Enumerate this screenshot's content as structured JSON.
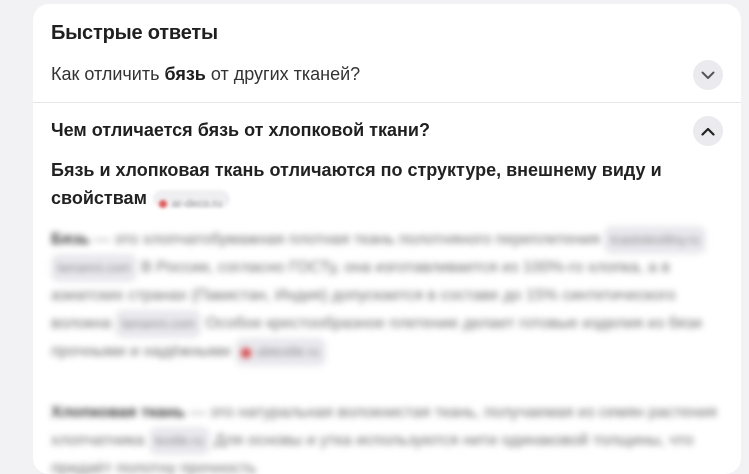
{
  "panel": {
    "title": "Быстрые ответы",
    "question1": {
      "prefix": "Как отличить ",
      "bold": "бязь",
      "suffix": " от других тканей?"
    },
    "question2": "Чем отличается бязь от хлопковой ткани?",
    "answer_lead": "Бязь и хлопковая ткань отличаются по структуре, внешнему виду и свойствам",
    "lead_source": "ar-deco.ru",
    "p1": {
      "term": "Бязь",
      "text1": " — это хлопчатобумажная плотная ткань полотняного переплетения ",
      "src1": "tcastotextilny.ru",
      "src2": "lamanni.com",
      "text2": " В России, согласно ГОСТу, она изготавливается из 100%-го хлопка, а в азиатских странах (Пакистан, Индия) допускается в составе до 15% синтетического волокна ",
      "src3": "lamanni.com",
      "text3": " Особое крестообразное плетение делает готовые изделия из бязи прочными и надёжными ",
      "src4": "ubtextile.ru"
    },
    "p2": {
      "term": "Хлопковая ткань",
      "text1": " — это натуральная волокнистая ткань, получаемая из семян растения хлопчатника ",
      "src1": "textile.ru",
      "text2": " Для основы и утка используются нити одинаковой толщины, что придаёт полотну прочность"
    }
  }
}
